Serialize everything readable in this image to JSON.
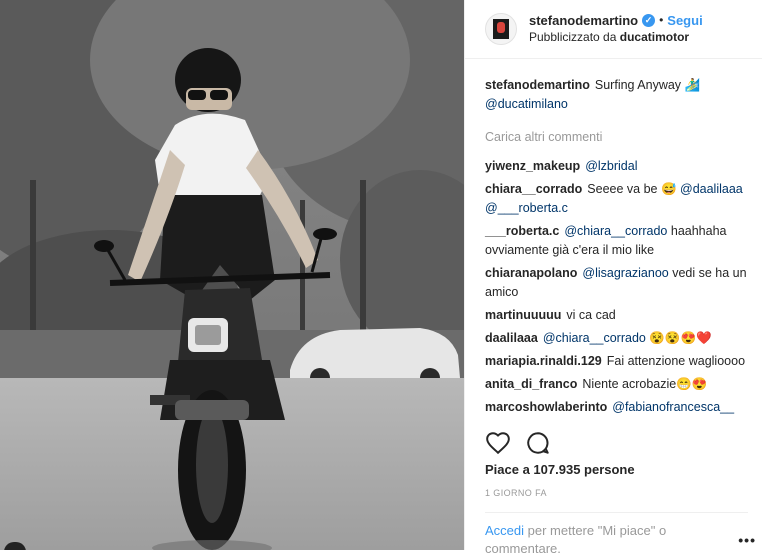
{
  "post": {
    "username": "stefanodemartino",
    "follow_label": "Segui",
    "dot": "•",
    "sponsored_prefix": "Pubblicizzato da",
    "sponsor": "ducatimotor"
  },
  "caption": {
    "username": "stefanodemartino",
    "text": "Surfing Anyway 🏄‍♂️",
    "mention": "@ducatimilano"
  },
  "load_more": "Carica altri commenti",
  "comments": [
    {
      "user": "yiwenz_makeup",
      "parts": [
        {
          "t": "@lzbridal",
          "link": true
        }
      ]
    },
    {
      "user": "chiara__corrado",
      "parts": [
        {
          "t": "Seeee va be 😅 ",
          "link": false
        },
        {
          "t": "@daalilaaa",
          "link": true
        },
        {
          "t": " ",
          "link": false
        },
        {
          "t": "@___roberta.c",
          "link": true
        }
      ]
    },
    {
      "user": "___roberta.c",
      "parts": [
        {
          "t": "@chiara__corrado",
          "link": true
        },
        {
          "t": " haahhaha ovviamente già c'era il mio like",
          "link": false
        }
      ]
    },
    {
      "user": "chiaranapolano",
      "parts": [
        {
          "t": "@lisagrazianoo",
          "link": true
        },
        {
          "t": " vedi se ha un amico",
          "link": false
        }
      ]
    },
    {
      "user": "martinuuuuu",
      "parts": [
        {
          "t": "vi ca cad",
          "link": false
        }
      ]
    },
    {
      "user": "daalilaaa",
      "parts": [
        {
          "t": "@chiara__corrado",
          "link": true
        },
        {
          "t": " 😵😵😍❤️",
          "link": false
        }
      ]
    },
    {
      "user": "mariapia.rinaldi.129",
      "parts": [
        {
          "t": "Fai attenzione waglioooo",
          "link": false
        }
      ]
    },
    {
      "user": "anita_di_franco",
      "parts": [
        {
          "t": "Niente acrobazie😁😍",
          "link": false
        }
      ]
    },
    {
      "user": "marcoshowlaberinto",
      "parts": [
        {
          "t": "@fabianofrancesca__",
          "link": true
        }
      ]
    }
  ],
  "likes": "Piace a 107.935 persone",
  "date": "1 GIORNO FA",
  "login": {
    "link": "Accedi",
    "rest": " per mettere \"Mi piace\" o commentare."
  },
  "more": "•••"
}
